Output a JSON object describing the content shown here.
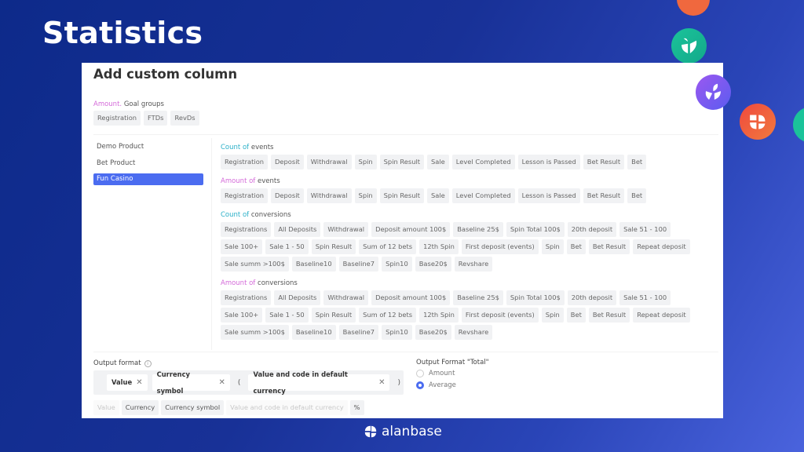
{
  "page": {
    "title": "Statistics"
  },
  "card": {
    "title": "Add custom column",
    "goal_groups": {
      "prefix": "Amount.",
      "label": "Goal groups",
      "chips": [
        "Registration",
        "FTDs",
        "RevDs"
      ]
    },
    "products": [
      {
        "label": "Demo Product",
        "active": false
      },
      {
        "label": "Bet Product",
        "active": false
      },
      {
        "label": "Fun Casino",
        "active": true
      }
    ],
    "sections": [
      {
        "prefix": "Count of",
        "suffix": "events",
        "accent": "teal",
        "chips": [
          "Registration",
          "Deposit",
          "Withdrawal",
          "Spin",
          "Spin Result",
          "Sale",
          "Level Completed",
          "Lesson is Passed",
          "Bet Result",
          "Bet"
        ]
      },
      {
        "prefix": "Amount of",
        "suffix": "events",
        "accent": "pink",
        "chips": [
          "Registration",
          "Deposit",
          "Withdrawal",
          "Spin",
          "Spin Result",
          "Sale",
          "Level Completed",
          "Lesson is Passed",
          "Bet Result",
          "Bet"
        ]
      },
      {
        "prefix": "Count of",
        "suffix": "conversions",
        "accent": "teal",
        "chips": [
          "Registrations",
          "All Deposits",
          "Withdrawal",
          "Deposit amount 100$",
          "Baseline 25$",
          "Spin Total 100$",
          "20th deposit",
          "Sale 51 - 100",
          "Sale 100+",
          "Sale 1 - 50",
          "Spin Result",
          "Sum of 12 bets",
          "12th Spin",
          "First deposit (events)",
          "Spin",
          "Bet",
          "Bet Result",
          "Repeat deposit",
          "Sale summ >100$",
          "Baseline10",
          "Baseline7",
          "Spin10",
          "Base20$",
          "Revshare"
        ]
      },
      {
        "prefix": "Amount of",
        "suffix": "conversions",
        "accent": "pink",
        "chips": [
          "Registrations",
          "All Deposits",
          "Withdrawal",
          "Deposit amount 100$",
          "Baseline 25$",
          "Spin Total 100$",
          "20th deposit",
          "Sale 51 - 100",
          "Sale 100+",
          "Sale 1 - 50",
          "Spin Result",
          "Sum of 12 bets",
          "12th Spin",
          "First deposit (events)",
          "Spin",
          "Bet",
          "Bet Result",
          "Repeat deposit",
          "Sale summ >100$",
          "Baseline10",
          "Baseline7",
          "Spin10",
          "Base20$",
          "Revshare"
        ]
      }
    ],
    "output_format": {
      "label": "Output format",
      "info_icon": "info-icon",
      "selected": [
        "Value",
        "Currency symbol",
        "(",
        "Value and code in default currency",
        ")"
      ],
      "options": [
        {
          "label": "Value",
          "disabled": true
        },
        {
          "label": "Currency",
          "disabled": false
        },
        {
          "label": "Currency symbol",
          "disabled": false
        },
        {
          "label": "Value and code in default currency",
          "disabled": true
        },
        {
          "label": "%",
          "disabled": false
        }
      ]
    },
    "output_total": {
      "label": "Output Format \"Total\"",
      "options": [
        {
          "label": "Amount",
          "checked": false
        },
        {
          "label": "Average",
          "checked": true
        }
      ]
    }
  },
  "footer": {
    "brand": "alanbase"
  },
  "colors": {
    "accent": "#4b6cf0",
    "pink": "#d46ad9",
    "teal": "#2bb0c8"
  }
}
